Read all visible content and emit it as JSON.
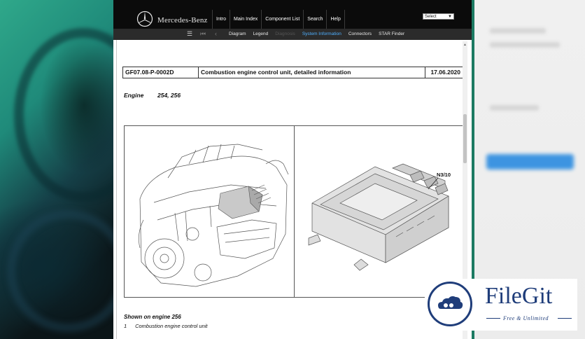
{
  "brand": {
    "name": "Mercedes-Benz"
  },
  "top_nav": [
    {
      "label": "Intro"
    },
    {
      "label": "Main Index"
    },
    {
      "label": "Component List"
    },
    {
      "label": "Search"
    },
    {
      "label": "Help"
    }
  ],
  "select": {
    "value": "Select"
  },
  "sub_nav": [
    {
      "label": "Diagram",
      "state": "normal"
    },
    {
      "label": "Legend",
      "state": "normal"
    },
    {
      "label": "Diagnosis",
      "state": "disabled"
    },
    {
      "label": "System Information",
      "state": "active"
    },
    {
      "label": "Connectors",
      "state": "normal"
    },
    {
      "label": "STAR Finder",
      "state": "normal"
    }
  ],
  "document": {
    "code": "GF07.08-P-0002D",
    "title": "Combustion engine control unit, detailed information",
    "date": "17.06.2020",
    "engine_label": "Engine",
    "engine_value": "254, 256",
    "callout": "N3/10",
    "caption_title": "Shown on engine 256",
    "caption_items": [
      {
        "num": "1",
        "text": "Combustion engine control unit"
      }
    ]
  },
  "watermark": {
    "title": "FileGit",
    "subtitle": "Free & Unlimited"
  },
  "colors": {
    "accent_active": "#4fb0ff",
    "topbar": "#0b0b0b",
    "watermark": "#1f3d7a"
  }
}
